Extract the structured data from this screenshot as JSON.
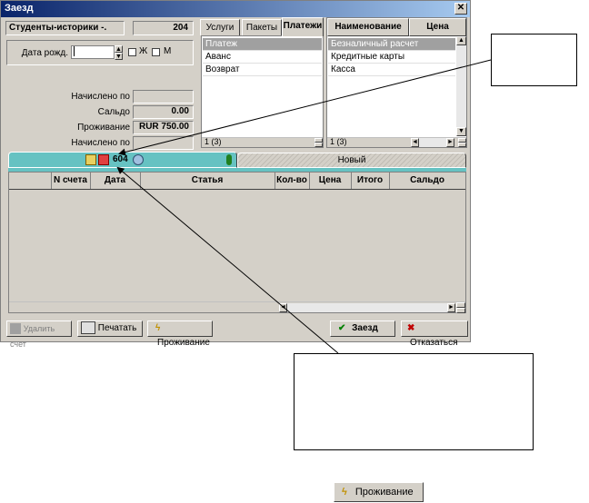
{
  "window": {
    "title": "Заезд",
    "close_glyph": "✕"
  },
  "group": {
    "name": "Студенты-историки -.",
    "room": "204"
  },
  "birthdate": {
    "label": "Дата рожд.",
    "value": "",
    "female_label": "Ж",
    "male_label": "М"
  },
  "fields": {
    "accrued_label": "Начислено по",
    "accrued_value": "",
    "balance_label": "Сальдо",
    "balance_value": "0.00",
    "stay_label": "Проживание",
    "stay_value": "RUR 750.00",
    "accrued2_label": "Начислено по",
    "accrued2_value": ""
  },
  "tabs": [
    "Услуги",
    "Пакеты",
    "Платежи"
  ],
  "payments_list": {
    "items": [
      "Платеж",
      "Аванс",
      "Возврат"
    ],
    "selected": 0,
    "count": "1 (3)"
  },
  "methods_table": {
    "columns": [
      "Наименование",
      "Цена"
    ],
    "rows": [
      "Безналичный расчет",
      "Кредитные карты",
      "Касса"
    ],
    "count": "1 (3)"
  },
  "account_tabs": {
    "active_label": "604",
    "new_label": "Новый"
  },
  "bills_table": {
    "columns": [
      "N счета",
      "Дата",
      "Статья",
      "Кол-во",
      "Цена",
      "Итого",
      "Сальдо"
    ]
  },
  "buttons": {
    "delete": "Удалить счет",
    "print": "Печатать",
    "stay": "Проживание",
    "checkin": "Заезд",
    "cancel": "Отказаться"
  },
  "sample_button": {
    "label": "Проживание"
  },
  "colors": {
    "teal": "#66c2c2",
    "selection": "#a0a0a0",
    "title": "#0a246a"
  }
}
